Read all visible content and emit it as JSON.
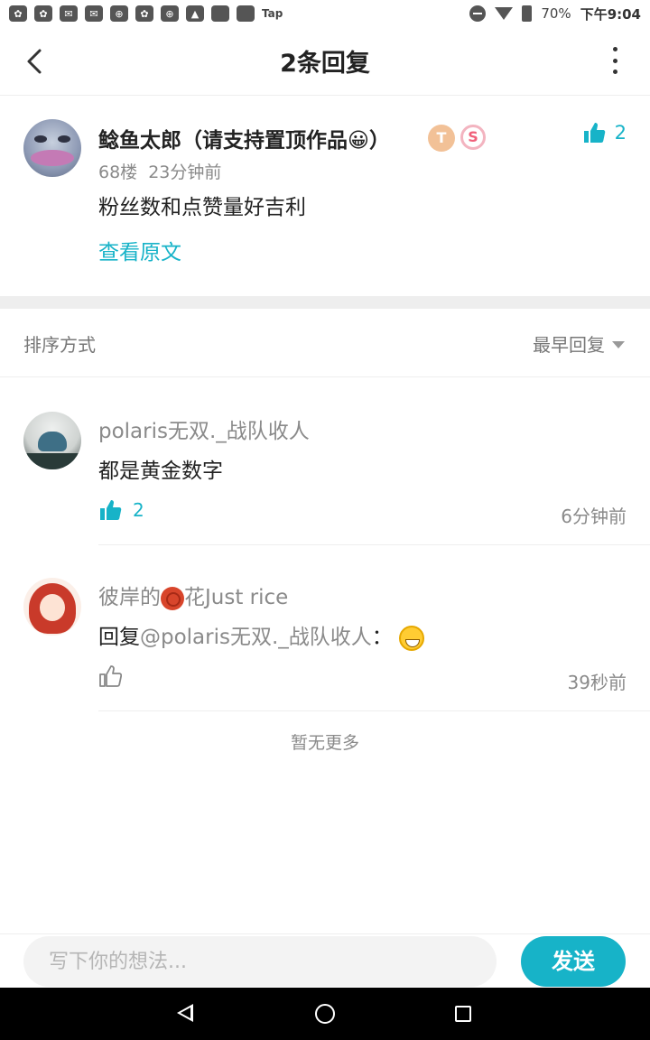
{
  "status_bar": {
    "left_icons": [
      "paw-icon",
      "paw-icon",
      "message-icon",
      "message-icon",
      "compass-icon",
      "paw-icon",
      "compass-icon",
      "image-icon",
      "app-icon",
      "app-icon"
    ],
    "tap_label": "Tap",
    "battery": "70%",
    "time": "下午9:04"
  },
  "header": {
    "title": "2条回复"
  },
  "main_comment": {
    "author": "鲶鱼太郎（请支持置顶作品😀）",
    "badge_t": "T",
    "badge_s": "S",
    "like_count": "2",
    "floor": "68楼",
    "time": "23分钟前",
    "text": "粉丝数和点赞量好吉利",
    "view_original": "查看原文"
  },
  "sort": {
    "label": "排序方式",
    "selected": "最早回复"
  },
  "replies": [
    {
      "author": "polaris无双._战队收人",
      "text": "都是黄金数字",
      "like_count": "2",
      "time": "6分钟前"
    },
    {
      "author_prefix": "彼岸的",
      "author_suffix": "花Just rice",
      "text_prefix": "回复",
      "mention": "@polaris无双._战队收人",
      "text_suffix": "：",
      "time": "39秒前"
    }
  ],
  "no_more": "暂无更多",
  "input": {
    "placeholder": "写下你的想法...",
    "send_label": "发送"
  },
  "colors": {
    "accent": "#17b3c8",
    "muted_text": "#8a8a8a"
  }
}
